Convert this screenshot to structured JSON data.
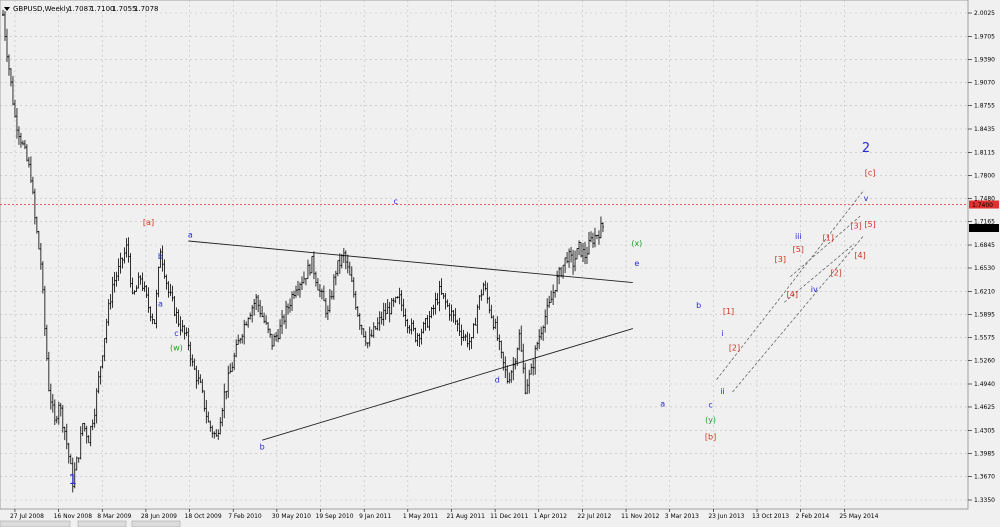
{
  "header": {
    "symbol_label": "GBPUSD,Weekly",
    "ohlc": [
      "1.7087",
      "1.7100",
      "1.7055",
      "1.7078"
    ]
  },
  "colors": {
    "background": "#f0f0f0",
    "grid": "#bdbdbd",
    "bars": "#000000",
    "wave_blue": "#2a2ad2",
    "wave_red": "#d0321e",
    "wave_green": "#1e9e2a",
    "level_line": "#e03030",
    "level_tag": "#e03030",
    "price_tag": "#000000"
  },
  "chart_data": {
    "type": "ohlc",
    "title": "GBPUSD,Weekly",
    "x_labels": [
      "27 Jul 2008",
      "16 Nov 2008",
      "8 Mar 2009",
      "28 Jun 2009",
      "18 Oct 2009",
      "7 Feb 2010",
      "30 May 2010",
      "19 Sep 2010",
      "9 Jan 2011",
      "1 May 2011",
      "21 Aug 2011",
      "11 Dec 2011",
      "1 Apr 2012",
      "22 Jul 2012",
      "11 Nov 2012",
      "3 Mar 2013",
      "23 Jun 2013",
      "13 Oct 2013",
      "2 Feb 2014",
      "25 May 2014"
    ],
    "y_ticks": [
      "2.0025",
      "1.9705",
      "1.9390",
      "1.9070",
      "1.8755",
      "1.8435",
      "1.8115",
      "1.7800",
      "1.7480",
      "1.7165",
      "1.6845",
      "1.6530",
      "1.6210",
      "1.5895",
      "1.5575",
      "1.5260",
      "1.4940",
      "1.4625",
      "1.4305",
      "1.3985",
      "1.3670",
      "1.3350"
    ],
    "ylim": [
      1.335,
      2.0025
    ],
    "grid": true,
    "last_price": 1.7078,
    "last_price_label": "1.7078",
    "horizontal_level": 1.74,
    "horizontal_level_label": "1.7400",
    "path_weeks": [
      0,
      2,
      6,
      10,
      14,
      16,
      19,
      21,
      23,
      26,
      28,
      31,
      35,
      38,
      40,
      43,
      46,
      49,
      52,
      55,
      58,
      62,
      63,
      65,
      69,
      73,
      76,
      79,
      83,
      88,
      93,
      95,
      99,
      103,
      107,
      111,
      115,
      119,
      123,
      127,
      131,
      135,
      139,
      143,
      147,
      151,
      155,
      159,
      163,
      167,
      171,
      175,
      179,
      183,
      187,
      191,
      195,
      199,
      203,
      207,
      211,
      215,
      219,
      223,
      227,
      231,
      235,
      238,
      241,
      244,
      247,
      250,
      253,
      256,
      259,
      262,
      265,
      268,
      271,
      274,
      277,
      280,
      283,
      286,
      289,
      292,
      295,
      298,
      301
    ],
    "path_closes": [
      2.0,
      1.95,
      1.86,
      1.82,
      1.78,
      1.72,
      1.66,
      1.57,
      1.49,
      1.44,
      1.47,
      1.43,
      1.36,
      1.4,
      1.44,
      1.42,
      1.46,
      1.52,
      1.58,
      1.63,
      1.65,
      1.68,
      1.67,
      1.61,
      1.64,
      1.6,
      1.58,
      1.68,
      1.62,
      1.58,
      1.55,
      1.52,
      1.49,
      1.44,
      1.42,
      1.48,
      1.52,
      1.56,
      1.59,
      1.61,
      1.58,
      1.55,
      1.57,
      1.6,
      1.63,
      1.64,
      1.66,
      1.62,
      1.59,
      1.65,
      1.67,
      1.63,
      1.58,
      1.55,
      1.57,
      1.59,
      1.6,
      1.61,
      1.58,
      1.56,
      1.57,
      1.59,
      1.62,
      1.6,
      1.58,
      1.56,
      1.55,
      1.6,
      1.63,
      1.6,
      1.57,
      1.53,
      1.5,
      1.52,
      1.56,
      1.49,
      1.51,
      1.55,
      1.58,
      1.6,
      1.63,
      1.65,
      1.67,
      1.66,
      1.68,
      1.67,
      1.69,
      1.7,
      1.71
    ],
    "trendlines": [
      {
        "points": [
          [
            93,
            1.69
          ],
          [
            316,
            1.633
          ]
        ],
        "style": "solid"
      },
      {
        "points": [
          [
            130,
            1.417
          ],
          [
            316,
            1.57
          ]
        ],
        "style": "solid"
      },
      {
        "points": [
          [
            358,
            1.5
          ],
          [
            432,
            1.76
          ]
        ],
        "style": "dashed"
      },
      {
        "points": [
          [
            366,
            1.483
          ],
          [
            432,
            1.698
          ]
        ],
        "style": "dashed"
      },
      {
        "points": [
          [
            392,
            1.606
          ],
          [
            427,
            1.686
          ]
        ],
        "style": "dashed"
      },
      {
        "points": [
          [
            395,
            1.641
          ],
          [
            430,
            1.724
          ]
        ],
        "style": "dashed"
      }
    ],
    "wave_labels": [
      {
        "text": "1",
        "week": 35,
        "price": 1.357,
        "color": "blue",
        "size": "big"
      },
      {
        "text": "[a]",
        "week": 73,
        "price": 1.712,
        "color": "red"
      },
      {
        "text": "b",
        "week": 79,
        "price": 1.665,
        "color": "blue"
      },
      {
        "text": "a",
        "week": 79,
        "price": 1.6,
        "color": "blue"
      },
      {
        "text": "c",
        "week": 87,
        "price": 1.56,
        "color": "blue"
      },
      {
        "text": "(w)",
        "week": 87,
        "price": 1.54,
        "color": "green"
      },
      {
        "text": "a",
        "week": 94,
        "price": 1.695,
        "color": "blue"
      },
      {
        "text": "b",
        "week": 130,
        "price": 1.404,
        "color": "blue"
      },
      {
        "text": "c",
        "week": 197,
        "price": 1.741,
        "color": "blue"
      },
      {
        "text": "d",
        "week": 248,
        "price": 1.496,
        "color": "blue"
      },
      {
        "text": "(x)",
        "week": 318,
        "price": 1.683,
        "color": "green"
      },
      {
        "text": "e",
        "week": 318,
        "price": 1.656,
        "color": "blue"
      },
      {
        "text": "a",
        "week": 331,
        "price": 1.463,
        "color": "blue"
      },
      {
        "text": "b",
        "week": 349,
        "price": 1.598,
        "color": "blue"
      },
      {
        "text": "c",
        "week": 355,
        "price": 1.462,
        "color": "blue"
      },
      {
        "text": "(y)",
        "week": 355,
        "price": 1.441,
        "color": "green"
      },
      {
        "text": "[b]",
        "week": 355,
        "price": 1.418,
        "color": "red"
      },
      {
        "text": "ii",
        "week": 361,
        "price": 1.48,
        "color": "blue"
      },
      {
        "text": "i",
        "week": 361,
        "price": 1.56,
        "color": "blue"
      },
      {
        "text": "[1]",
        "week": 364,
        "price": 1.59,
        "color": "red"
      },
      {
        "text": "[2]",
        "week": 367,
        "price": 1.54,
        "color": "red"
      },
      {
        "text": "[3]",
        "week": 390,
        "price": 1.661,
        "color": "red"
      },
      {
        "text": "[4]",
        "week": 396,
        "price": 1.613,
        "color": "red"
      },
      {
        "text": "[5]",
        "week": 399,
        "price": 1.675,
        "color": "red"
      },
      {
        "text": "iii",
        "week": 399,
        "price": 1.693,
        "color": "blue"
      },
      {
        "text": "iv",
        "week": 407,
        "price": 1.62,
        "color": "blue"
      },
      {
        "text": "[1]",
        "week": 414,
        "price": 1.691,
        "color": "red"
      },
      {
        "text": "[2]",
        "week": 418,
        "price": 1.643,
        "color": "red"
      },
      {
        "text": "[3]",
        "week": 428,
        "price": 1.707,
        "color": "red"
      },
      {
        "text": "[4]",
        "week": 430,
        "price": 1.667,
        "color": "red"
      },
      {
        "text": "[5]",
        "week": 435,
        "price": 1.709,
        "color": "red"
      },
      {
        "text": "v",
        "week": 433,
        "price": 1.745,
        "color": "blue"
      },
      {
        "text": "[c]",
        "week": 435,
        "price": 1.78,
        "color": "red"
      },
      {
        "text": "2",
        "week": 433,
        "price": 1.812,
        "color": "blue",
        "size": "big"
      }
    ]
  }
}
